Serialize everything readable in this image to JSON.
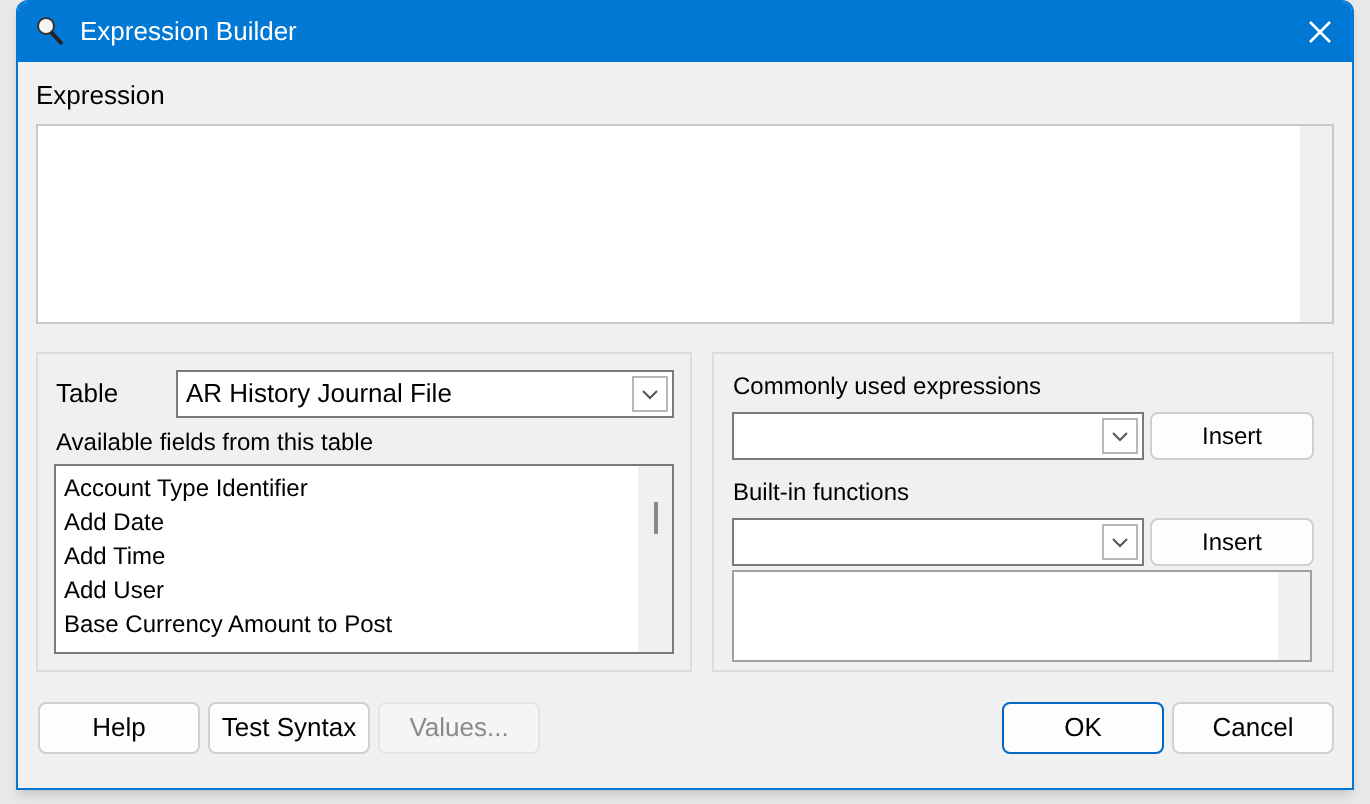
{
  "window": {
    "title": "Expression Builder"
  },
  "expression": {
    "label": "Expression"
  },
  "table": {
    "label": "Table",
    "value": "AR History Journal File"
  },
  "fields": {
    "label": "Available fields from this table",
    "items": [
      {
        "text": "Account Type Identifier",
        "selected": false
      },
      {
        "text": "Add Date",
        "selected": false
      },
      {
        "text": "Add Time",
        "selected": false
      },
      {
        "text": "Add User",
        "selected": false
      },
      {
        "text": "Base Currency Amount to Post",
        "selected": false
      }
    ]
  },
  "common": {
    "label": "Commonly used expressions",
    "button": "Insert"
  },
  "builtin": {
    "label": "Built-in functions",
    "button": "Insert"
  },
  "buttons": [
    {
      "label": "Help",
      "disabled": false,
      "default": false
    },
    {
      "label": "Test Syntax",
      "disabled": false,
      "default": false
    },
    {
      "label": "Values...",
      "disabled": true,
      "default": false
    },
    {
      "label": "OK",
      "disabled": false,
      "default": true
    },
    {
      "label": "Cancel",
      "disabled": false,
      "default": false
    }
  ]
}
